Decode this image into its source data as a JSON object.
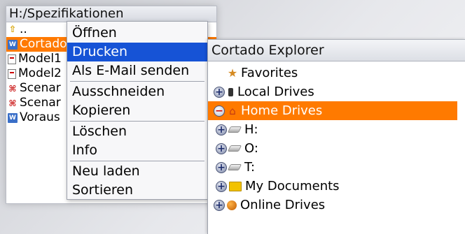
{
  "file_list": {
    "title": "H:/Spezifikationen",
    "items": [
      {
        "label": "..",
        "icon": "folder-up-icon"
      },
      {
        "label": "Cortado",
        "icon": "word-doc-icon",
        "selected": true
      },
      {
        "label": "Model1",
        "icon": "document-icon"
      },
      {
        "label": "Model2",
        "icon": "document-icon"
      },
      {
        "label": "Scenar",
        "icon": "pdf-icon"
      },
      {
        "label": "Scenar",
        "icon": "pdf-icon"
      },
      {
        "label": "Voraus",
        "icon": "word-doc-icon"
      }
    ]
  },
  "context_menu": {
    "items": [
      {
        "label": "Öffnen"
      },
      {
        "label": "Drucken",
        "active": true
      },
      {
        "label": "Als E-Mail senden"
      },
      {
        "label": "Ausschneiden"
      },
      {
        "label": "Kopieren"
      },
      {
        "label": "Löschen"
      },
      {
        "label": "Info"
      },
      {
        "label": "Neu laden"
      },
      {
        "label": "Sortieren"
      }
    ]
  },
  "explorer": {
    "title": "Cortado Explorer",
    "nodes": [
      {
        "label": "Favorites",
        "icon": "star-icon",
        "toggle": "none"
      },
      {
        "label": "Local Drives",
        "icon": "phone-icon",
        "toggle": "expand"
      },
      {
        "label": "Home Drives",
        "icon": "home-icon",
        "toggle": "collapse",
        "selected": true
      },
      {
        "label": "H:",
        "icon": "drive-icon",
        "toggle": "expand"
      },
      {
        "label": "O:",
        "icon": "drive-icon",
        "toggle": "expand"
      },
      {
        "label": "T:",
        "icon": "drive-icon",
        "toggle": "expand"
      },
      {
        "label": "My Documents",
        "icon": "folder-icon",
        "toggle": "expand"
      },
      {
        "label": "Online Drives",
        "icon": "globe-icon",
        "toggle": "expand"
      }
    ]
  },
  "colors": {
    "selection_orange": "#ff7a00",
    "menu_highlight_blue": "#1653d6"
  },
  "glyphs": {
    "expand": "+",
    "collapse": "−",
    "star": "★",
    "home": "⌂",
    "folder_up": "⇧",
    "doc": "W",
    "pdf": "⌘"
  }
}
